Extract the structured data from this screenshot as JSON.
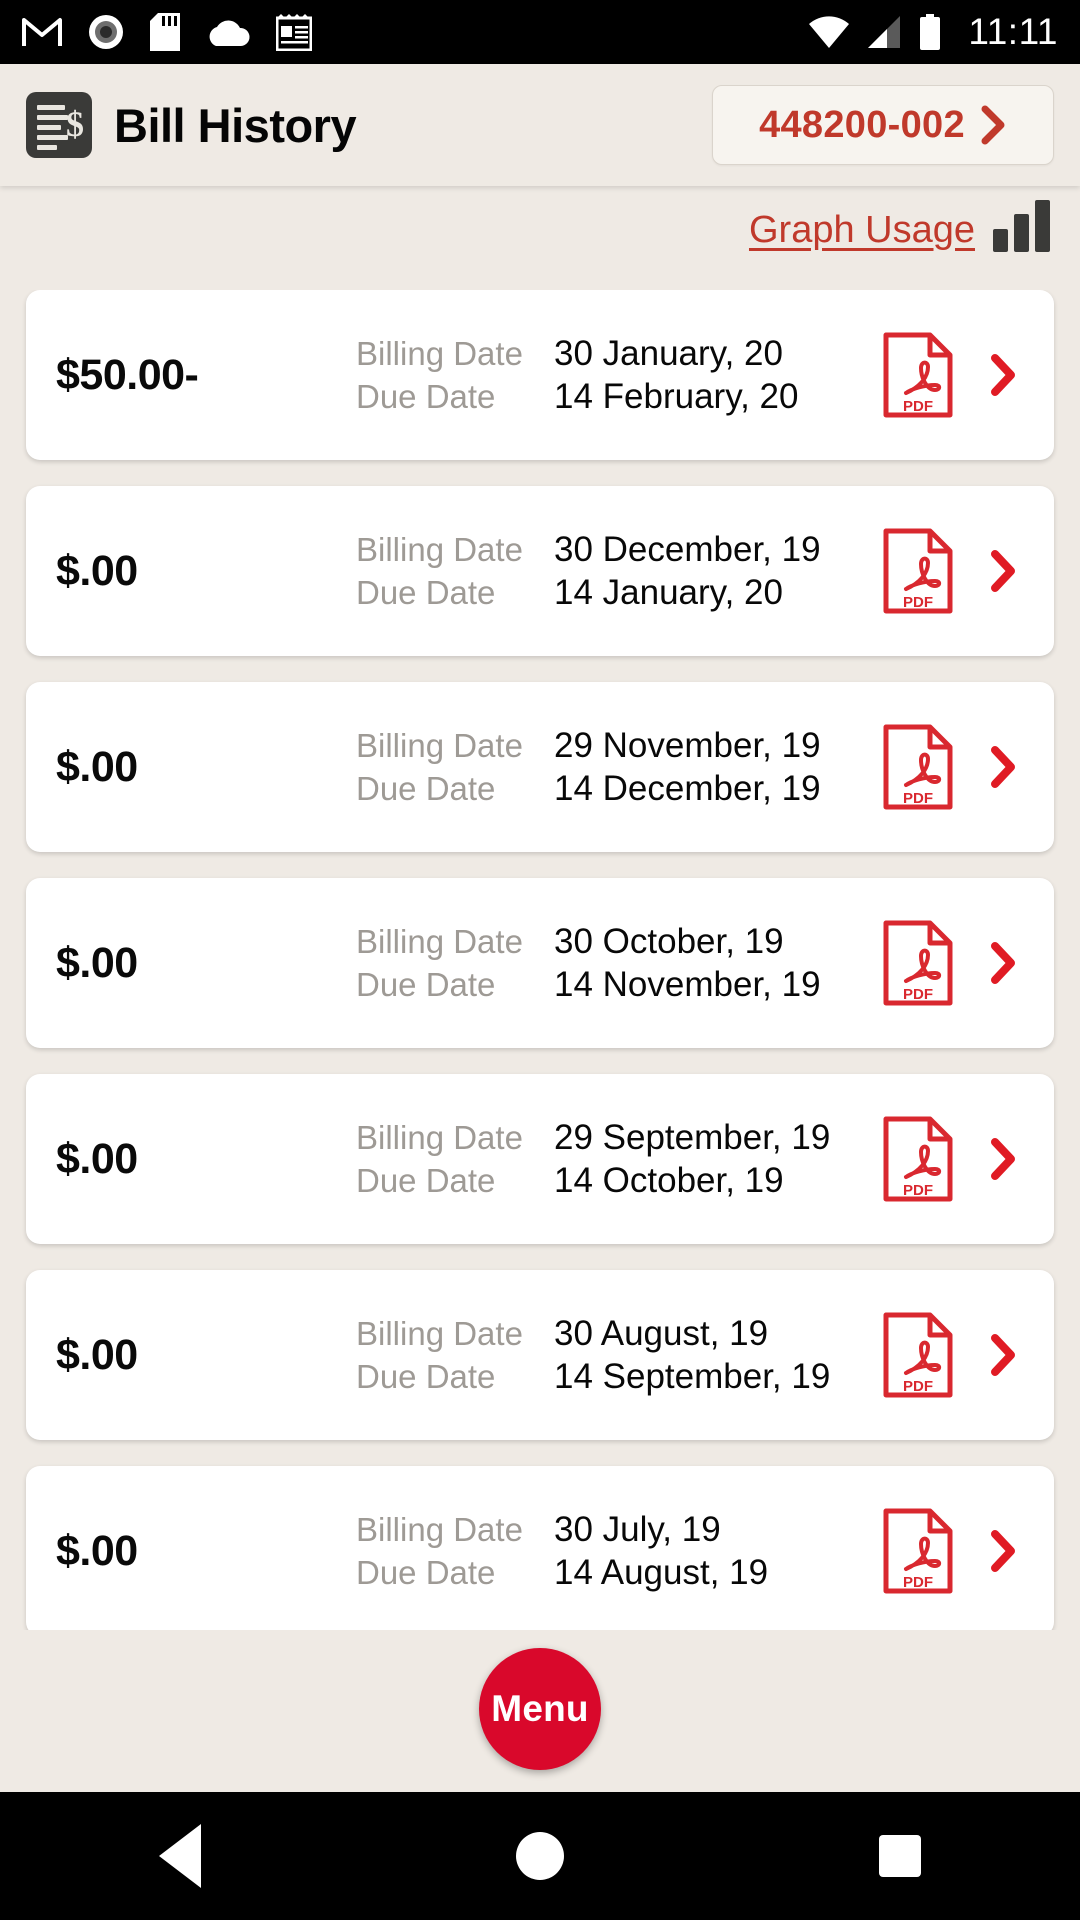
{
  "status_bar": {
    "time": "11:11",
    "left_icons": [
      "gmail-icon",
      "record-circle-icon",
      "sd-card-icon",
      "cloud-icon",
      "notepad-icon"
    ],
    "right_icons": [
      "wifi-icon",
      "cellular-signal-icon",
      "battery-icon"
    ]
  },
  "header": {
    "icon": "bill-document-dollar-icon",
    "title": "Bill History",
    "account_button": {
      "label": "448200-002",
      "chevron": "chevron-right-icon",
      "accent": "#C0392B"
    }
  },
  "usage": {
    "link_label": "Graph Usage",
    "icon": "bar-chart-icon"
  },
  "labels": {
    "billing_date": "Billing Date",
    "due_date": "Due Date",
    "pdf": "PDF"
  },
  "bills": [
    {
      "amount": "$50.00-",
      "billing_date": "30 January, 20",
      "due_date": "14 February, 20"
    },
    {
      "amount": "$.00",
      "billing_date": "30 December, 19",
      "due_date": "14 January, 20"
    },
    {
      "amount": "$.00",
      "billing_date": "29 November, 19",
      "due_date": "14 December, 19"
    },
    {
      "amount": "$.00",
      "billing_date": "30 October, 19",
      "due_date": "14 November, 19"
    },
    {
      "amount": "$.00",
      "billing_date": "29 September, 19",
      "due_date": "14 October, 19"
    },
    {
      "amount": "$.00",
      "billing_date": "30 August, 19",
      "due_date": "14 September, 19"
    },
    {
      "amount": "$.00",
      "billing_date": "30 July, 19",
      "due_date": "14 August, 19"
    }
  ],
  "fab": {
    "label": "Menu",
    "color": "#D9082B"
  },
  "nav_bar": {
    "back": "back-triangle-icon",
    "home": "home-circle-icon",
    "recents": "recents-square-icon"
  },
  "theme": {
    "background": "#EFEAE4",
    "card": "#FFFFFF",
    "accent_red": "#C0392B",
    "muted_text": "#9E9A95"
  }
}
